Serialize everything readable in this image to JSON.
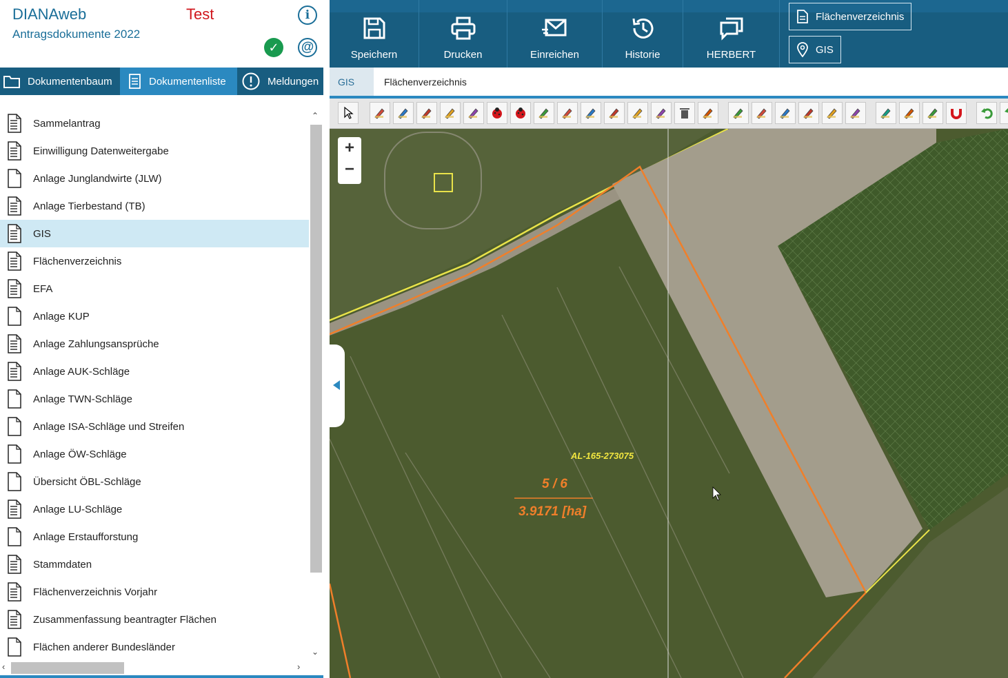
{
  "header": {
    "app_title": "DIANAweb",
    "app_subtitle": "Antragsdokumente 2022",
    "environment": "Test",
    "info_icon": "i",
    "status_icon": "✓",
    "mail_icon": "@"
  },
  "tabs": [
    {
      "label": "Dokumentenbaum",
      "icon": "folder-icon"
    },
    {
      "label": "Dokumentenliste",
      "icon": "list-icon",
      "active": true
    },
    {
      "label": "Meldungen",
      "icon": "alert-icon"
    }
  ],
  "documents": [
    {
      "label": "Sammelantrag",
      "filled": true
    },
    {
      "label": "Einwilligung Datenweitergabe",
      "filled": true
    },
    {
      "label": "Anlage Junglandwirte (JLW)",
      "filled": false
    },
    {
      "label": "Anlage Tierbestand (TB)",
      "filled": true
    },
    {
      "label": "GIS",
      "filled": true,
      "selected": true
    },
    {
      "label": "Flächenverzeichnis",
      "filled": true
    },
    {
      "label": "EFA",
      "filled": true
    },
    {
      "label": "Anlage KUP",
      "filled": false
    },
    {
      "label": "Anlage Zahlungsansprüche",
      "filled": true
    },
    {
      "label": "Anlage AUK-Schläge",
      "filled": true
    },
    {
      "label": "Anlage TWN-Schläge",
      "filled": false
    },
    {
      "label": "Anlage ISA-Schläge und Streifen",
      "filled": false
    },
    {
      "label": "Anlage ÖW-Schläge",
      "filled": false
    },
    {
      "label": "Übersicht ÖBL-Schläge",
      "filled": false
    },
    {
      "label": "Anlage LU-Schläge",
      "filled": true
    },
    {
      "label": "Anlage Erstaufforstung",
      "filled": false
    },
    {
      "label": "Stammdaten",
      "filled": true
    },
    {
      "label": "Flächenverzeichnis Vorjahr",
      "filled": true
    },
    {
      "label": "Zusammenfassung beantragter Flächen",
      "filled": true
    },
    {
      "label": "Flächen anderer Bundesländer",
      "filled": false
    }
  ],
  "toolbar": {
    "save": "Speichern",
    "print": "Drucken",
    "submit": "Einreichen",
    "history": "Historie",
    "herbert": "HERBERT",
    "flaechenverzeichnis": "Flächenverzeichnis",
    "gis": "GIS"
  },
  "breadcrumb": {
    "gis": "GIS",
    "current": "Flächenverzeichnis"
  },
  "gis_tools": [
    "select-arrow-icon",
    "add-field-icon",
    "edit-pencil-red-icon",
    "edit-pencil-blue-icon",
    "draw-polygon-icon",
    "edit-pencil-small-icon",
    "ladybug-icon",
    "ladybug-pencil-icon",
    "edit-pencil-grey-icon",
    "edit-pencil-orange-icon",
    "edit-pencil-green-icon",
    "split-icon",
    "merge-icon",
    "nodes-icon",
    "delete-icon",
    "move-icon",
    "zoom-layer-icon",
    "zoom-layer-out-icon",
    "layer-down-icon",
    "layers-icon",
    "measure-icon",
    "measure-area-icon",
    "add-point-icon",
    "print-map-icon",
    "legend-icon",
    "magnet-icon",
    "undo-icon",
    "redo-icon"
  ],
  "map": {
    "zoom_in": "+",
    "zoom_out": "−",
    "parcel_id": "AL-165-273075",
    "parcel_fraction": "5 / 6",
    "parcel_area": "3.9171 [ha]",
    "label_color_id": "#f2e640",
    "label_color_area": "#f07f2a"
  },
  "colors": {
    "brand": "#185d80",
    "accent": "#2b89c0",
    "env_red": "#d0161c",
    "status_green": "#199a4f"
  }
}
